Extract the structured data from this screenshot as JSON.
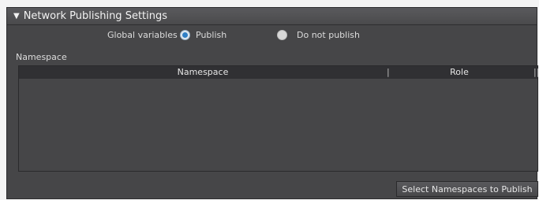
{
  "section": {
    "title": "Network Publishing Settings",
    "toggle_icon": "triangle-down-icon"
  },
  "global_variables": {
    "label": "Global variables",
    "options": [
      {
        "label": "Publish",
        "selected": true
      },
      {
        "label": "Do not publish",
        "selected": false
      }
    ]
  },
  "namespace": {
    "label": "Namespace",
    "columns": [
      "Namespace",
      "Role"
    ],
    "separators": [
      "|",
      "||"
    ],
    "rows": []
  },
  "actions": {
    "select_namespaces_label": "Select Namespaces to Publish"
  },
  "colors": {
    "panel_bg": "#464648",
    "header_bg": "#303033",
    "radio_selected": "#2f7fc6"
  }
}
